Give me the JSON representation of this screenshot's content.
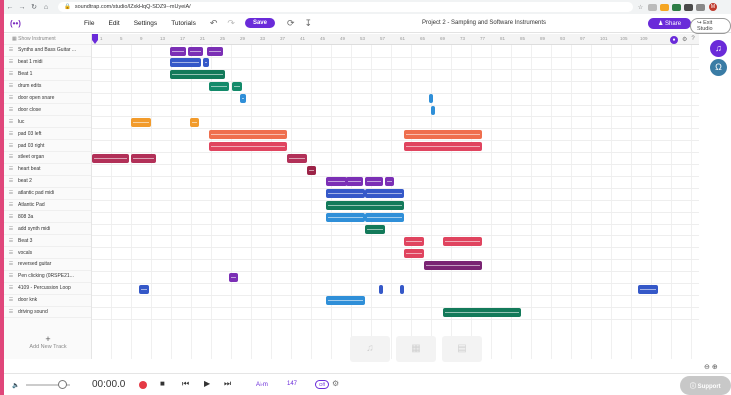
{
  "browser": {
    "url": "soundtrap.com/studio/lZxkHqQ-SDZ9--mUyeiA/",
    "avatar": "M"
  },
  "app": {
    "logo": "(••)",
    "menu": [
      "File",
      "Edit",
      "Settings",
      "Tutorials"
    ],
    "save_label": "Save",
    "project_title": "Project 2 - Sampling and Software Instruments",
    "share_label": "Share",
    "exit_label": "Exit Studio",
    "show_instrument_label": "Show Instrument"
  },
  "tracks": [
    {
      "name": "Synths and Bass Guitar ..."
    },
    {
      "name": "beat 1 midi"
    },
    {
      "name": "Beat 1"
    },
    {
      "name": "drum edits"
    },
    {
      "name": "door open snare"
    },
    {
      "name": "door close"
    },
    {
      "name": "luc"
    },
    {
      "name": "pad 03 left"
    },
    {
      "name": "pad 03 right"
    },
    {
      "name": "stleet organ"
    },
    {
      "name": "heart beat"
    },
    {
      "name": "beat 2"
    },
    {
      "name": "atlantic pad midi"
    },
    {
      "name": "Atlantic Pad"
    },
    {
      "name": "808 3a"
    },
    {
      "name": "add synth midi"
    },
    {
      "name": "Beat 3"
    },
    {
      "name": "vocals"
    },
    {
      "name": "reversed guitar"
    },
    {
      "name": "Pen clicking (0RSPE21..."
    },
    {
      "name": "4109 - Percussion Loop"
    },
    {
      "name": "door knk"
    },
    {
      "name": "driving sound"
    }
  ],
  "add_track_label": "Add New Track",
  "ruler_ticks": [
    "1",
    "5",
    "9",
    "13",
    "17",
    "21",
    "25",
    "29",
    "33",
    "37",
    "41",
    "45",
    "49",
    "53",
    "57",
    "61",
    "65",
    "69",
    "73",
    "77",
    "81",
    "85",
    "89",
    "93",
    "97",
    "101",
    "105",
    "109"
  ],
  "colors": {
    "purple": "#7b2fb5",
    "blue": "#3558c8",
    "green": "#137a5a",
    "teal": "#138a6a",
    "skyblue": "#2f8fd8",
    "orange": "#f29b2b",
    "salmon": "#ef6f4e",
    "red": "#e0445f",
    "crimson": "#b23058",
    "darkred": "#9c2347",
    "magenta": "#7a2473",
    "brand": "#6a2bd9"
  },
  "clips": [
    {
      "track": 0,
      "start": 41,
      "len": 8,
      "color": "purple"
    },
    {
      "track": 0,
      "start": 50,
      "len": 8,
      "color": "purple"
    },
    {
      "track": 0,
      "start": 60,
      "len": 8,
      "color": "purple"
    },
    {
      "track": 1,
      "start": 41,
      "len": 16,
      "color": "blue"
    },
    {
      "track": 1,
      "start": 58,
      "len": 3,
      "color": "blue"
    },
    {
      "track": 2,
      "start": 41,
      "len": 28,
      "color": "green"
    },
    {
      "track": 3,
      "start": 61,
      "len": 10,
      "color": "teal"
    },
    {
      "track": 3,
      "start": 73,
      "len": 5,
      "color": "teal"
    },
    {
      "track": 4,
      "start": 77,
      "len": 3,
      "color": "skyblue"
    },
    {
      "track": 4,
      "start": 174,
      "len": 1,
      "color": "skyblue"
    },
    {
      "track": 5,
      "start": 175,
      "len": 1,
      "color": "skyblue"
    },
    {
      "track": 6,
      "start": 21,
      "len": 10,
      "color": "orange"
    },
    {
      "track": 6,
      "start": 51,
      "len": 5,
      "color": "orange"
    },
    {
      "track": 7,
      "start": 61,
      "len": 40,
      "color": "salmon"
    },
    {
      "track": 7,
      "start": 161,
      "len": 40,
      "color": "salmon"
    },
    {
      "track": 8,
      "start": 61,
      "len": 40,
      "color": "red"
    },
    {
      "track": 8,
      "start": 161,
      "len": 40,
      "color": "red"
    },
    {
      "track": 9,
      "start": 1,
      "len": 19,
      "color": "crimson"
    },
    {
      "track": 9,
      "start": 21,
      "len": 13,
      "color": "crimson"
    },
    {
      "track": 9,
      "start": 101,
      "len": 10,
      "color": "crimson"
    },
    {
      "track": 10,
      "start": 111,
      "len": 5,
      "color": "darkred"
    },
    {
      "track": 11,
      "start": 121,
      "len": 11,
      "color": "purple"
    },
    {
      "track": 11,
      "start": 131,
      "len": 9,
      "color": "purple"
    },
    {
      "track": 11,
      "start": 141,
      "len": 9,
      "color": "purple"
    },
    {
      "track": 11,
      "start": 151,
      "len": 5,
      "color": "purple"
    },
    {
      "track": 12,
      "start": 121,
      "len": 20,
      "color": "blue"
    },
    {
      "track": 12,
      "start": 141,
      "len": 20,
      "color": "blue"
    },
    {
      "track": 13,
      "start": 121,
      "len": 40,
      "color": "green"
    },
    {
      "track": 14,
      "start": 121,
      "len": 20,
      "color": "skyblue"
    },
    {
      "track": 14,
      "start": 141,
      "len": 20,
      "color": "skyblue"
    },
    {
      "track": 15,
      "start": 141,
      "len": 10,
      "color": "green"
    },
    {
      "track": 16,
      "start": 161,
      "len": 10,
      "color": "red"
    },
    {
      "track": 16,
      "start": 181,
      "len": 20,
      "color": "red"
    },
    {
      "track": 17,
      "start": 161,
      "len": 10,
      "color": "red"
    },
    {
      "track": 18,
      "start": 171,
      "len": 30,
      "color": "magenta"
    },
    {
      "track": 19,
      "start": 71,
      "len": 5,
      "color": "purple"
    },
    {
      "track": 20,
      "start": 25,
      "len": 5,
      "color": "blue"
    },
    {
      "track": 20,
      "start": 148,
      "len": 1,
      "color": "blue"
    },
    {
      "track": 20,
      "start": 159,
      "len": 1,
      "color": "blue"
    },
    {
      "track": 20,
      "start": 281,
      "len": 10,
      "color": "blue"
    },
    {
      "track": 21,
      "start": 121,
      "len": 20,
      "color": "skyblue"
    },
    {
      "track": 22,
      "start": 181,
      "len": 40,
      "color": "green"
    }
  ],
  "transport": {
    "time": "00:00.0",
    "key": "A♭m",
    "tempo": "147",
    "metronome_toggle": "Off",
    "support_label": "Support"
  }
}
